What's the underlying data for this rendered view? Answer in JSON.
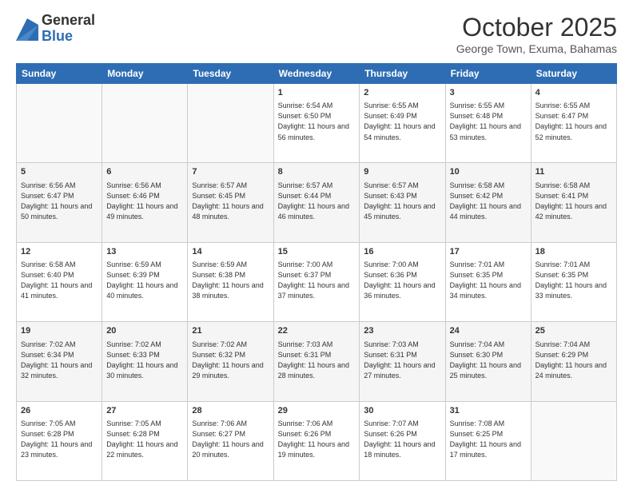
{
  "logo": {
    "general": "General",
    "blue": "Blue"
  },
  "header": {
    "month": "October 2025",
    "location": "George Town, Exuma, Bahamas"
  },
  "weekdays": [
    "Sunday",
    "Monday",
    "Tuesday",
    "Wednesday",
    "Thursday",
    "Friday",
    "Saturday"
  ],
  "weeks": [
    [
      {
        "day": "",
        "info": ""
      },
      {
        "day": "",
        "info": ""
      },
      {
        "day": "",
        "info": ""
      },
      {
        "day": "1",
        "info": "Sunrise: 6:54 AM\nSunset: 6:50 PM\nDaylight: 11 hours and 56 minutes."
      },
      {
        "day": "2",
        "info": "Sunrise: 6:55 AM\nSunset: 6:49 PM\nDaylight: 11 hours and 54 minutes."
      },
      {
        "day": "3",
        "info": "Sunrise: 6:55 AM\nSunset: 6:48 PM\nDaylight: 11 hours and 53 minutes."
      },
      {
        "day": "4",
        "info": "Sunrise: 6:55 AM\nSunset: 6:47 PM\nDaylight: 11 hours and 52 minutes."
      }
    ],
    [
      {
        "day": "5",
        "info": "Sunrise: 6:56 AM\nSunset: 6:47 PM\nDaylight: 11 hours and 50 minutes."
      },
      {
        "day": "6",
        "info": "Sunrise: 6:56 AM\nSunset: 6:46 PM\nDaylight: 11 hours and 49 minutes."
      },
      {
        "day": "7",
        "info": "Sunrise: 6:57 AM\nSunset: 6:45 PM\nDaylight: 11 hours and 48 minutes."
      },
      {
        "day": "8",
        "info": "Sunrise: 6:57 AM\nSunset: 6:44 PM\nDaylight: 11 hours and 46 minutes."
      },
      {
        "day": "9",
        "info": "Sunrise: 6:57 AM\nSunset: 6:43 PM\nDaylight: 11 hours and 45 minutes."
      },
      {
        "day": "10",
        "info": "Sunrise: 6:58 AM\nSunset: 6:42 PM\nDaylight: 11 hours and 44 minutes."
      },
      {
        "day": "11",
        "info": "Sunrise: 6:58 AM\nSunset: 6:41 PM\nDaylight: 11 hours and 42 minutes."
      }
    ],
    [
      {
        "day": "12",
        "info": "Sunrise: 6:58 AM\nSunset: 6:40 PM\nDaylight: 11 hours and 41 minutes."
      },
      {
        "day": "13",
        "info": "Sunrise: 6:59 AM\nSunset: 6:39 PM\nDaylight: 11 hours and 40 minutes."
      },
      {
        "day": "14",
        "info": "Sunrise: 6:59 AM\nSunset: 6:38 PM\nDaylight: 11 hours and 38 minutes."
      },
      {
        "day": "15",
        "info": "Sunrise: 7:00 AM\nSunset: 6:37 PM\nDaylight: 11 hours and 37 minutes."
      },
      {
        "day": "16",
        "info": "Sunrise: 7:00 AM\nSunset: 6:36 PM\nDaylight: 11 hours and 36 minutes."
      },
      {
        "day": "17",
        "info": "Sunrise: 7:01 AM\nSunset: 6:35 PM\nDaylight: 11 hours and 34 minutes."
      },
      {
        "day": "18",
        "info": "Sunrise: 7:01 AM\nSunset: 6:35 PM\nDaylight: 11 hours and 33 minutes."
      }
    ],
    [
      {
        "day": "19",
        "info": "Sunrise: 7:02 AM\nSunset: 6:34 PM\nDaylight: 11 hours and 32 minutes."
      },
      {
        "day": "20",
        "info": "Sunrise: 7:02 AM\nSunset: 6:33 PM\nDaylight: 11 hours and 30 minutes."
      },
      {
        "day": "21",
        "info": "Sunrise: 7:02 AM\nSunset: 6:32 PM\nDaylight: 11 hours and 29 minutes."
      },
      {
        "day": "22",
        "info": "Sunrise: 7:03 AM\nSunset: 6:31 PM\nDaylight: 11 hours and 28 minutes."
      },
      {
        "day": "23",
        "info": "Sunrise: 7:03 AM\nSunset: 6:31 PM\nDaylight: 11 hours and 27 minutes."
      },
      {
        "day": "24",
        "info": "Sunrise: 7:04 AM\nSunset: 6:30 PM\nDaylight: 11 hours and 25 minutes."
      },
      {
        "day": "25",
        "info": "Sunrise: 7:04 AM\nSunset: 6:29 PM\nDaylight: 11 hours and 24 minutes."
      }
    ],
    [
      {
        "day": "26",
        "info": "Sunrise: 7:05 AM\nSunset: 6:28 PM\nDaylight: 11 hours and 23 minutes."
      },
      {
        "day": "27",
        "info": "Sunrise: 7:05 AM\nSunset: 6:28 PM\nDaylight: 11 hours and 22 minutes."
      },
      {
        "day": "28",
        "info": "Sunrise: 7:06 AM\nSunset: 6:27 PM\nDaylight: 11 hours and 20 minutes."
      },
      {
        "day": "29",
        "info": "Sunrise: 7:06 AM\nSunset: 6:26 PM\nDaylight: 11 hours and 19 minutes."
      },
      {
        "day": "30",
        "info": "Sunrise: 7:07 AM\nSunset: 6:26 PM\nDaylight: 11 hours and 18 minutes."
      },
      {
        "day": "31",
        "info": "Sunrise: 7:08 AM\nSunset: 6:25 PM\nDaylight: 11 hours and 17 minutes."
      },
      {
        "day": "",
        "info": ""
      }
    ]
  ]
}
